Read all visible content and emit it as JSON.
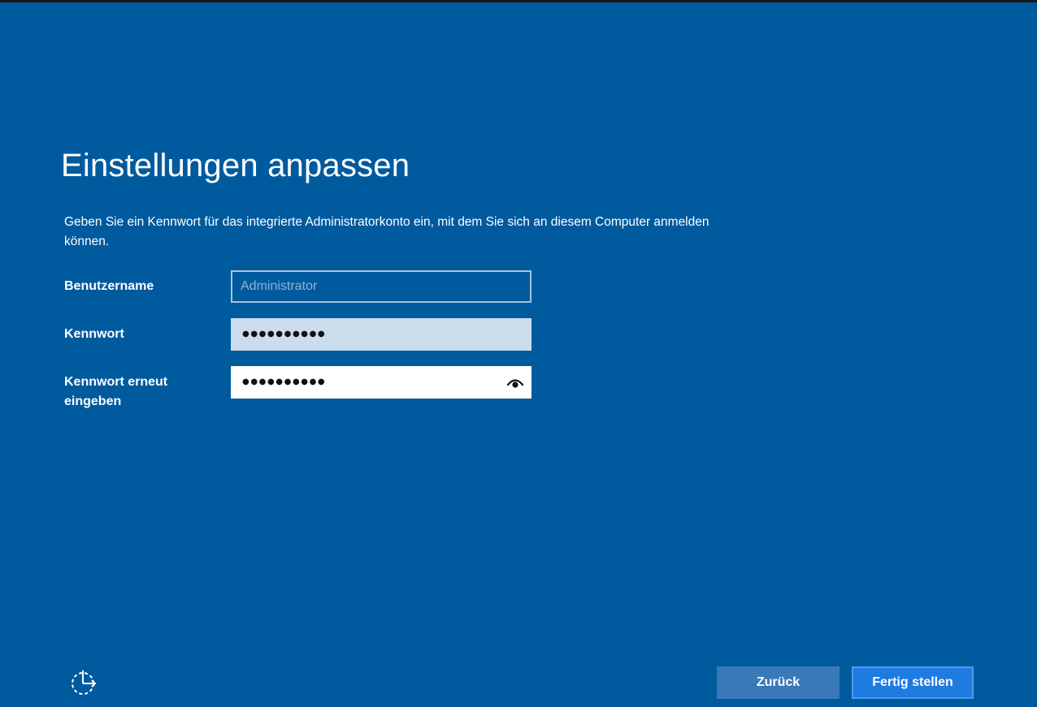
{
  "header": {
    "title": "Einstellungen anpassen"
  },
  "main": {
    "description": "Geben Sie ein Kennwort für das integrierte Administratorkonto ein, mit dem Sie sich an diesem Computer anmelden können.",
    "fields": {
      "username": {
        "label": "Benutzername",
        "value": "",
        "placeholder": "Administrator"
      },
      "password": {
        "label": "Kennwort",
        "masked_value": "●●●●●●●●●●"
      },
      "confirm_password": {
        "label_line1": "Kennwort erneut",
        "label_line2": "eingeben",
        "masked_value": "●●●●●●●●●●",
        "reveal_icon": "eye-icon"
      }
    }
  },
  "footer": {
    "ease_of_access_icon": "ease-of-access-icon",
    "back_label": "Zurück",
    "finish_label": "Fertig stellen"
  },
  "colors": {
    "background": "#005a9e",
    "back_button": "#3a79b8",
    "finish_button": "#1e7be0",
    "password_field_focused": "#cbdcec"
  }
}
